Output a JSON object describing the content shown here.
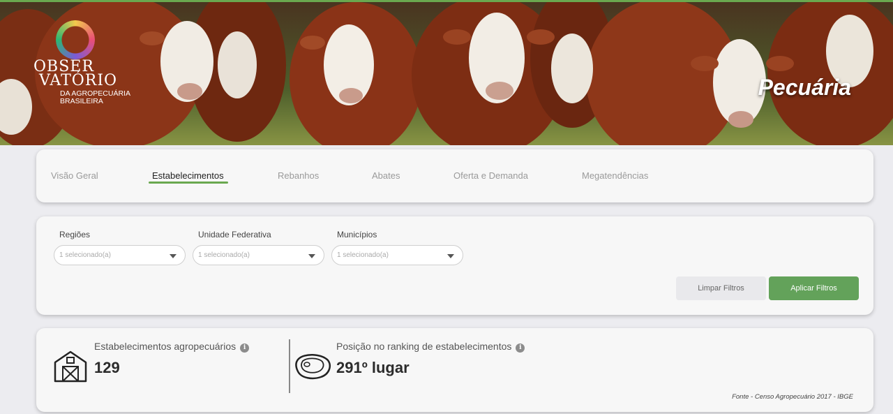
{
  "header": {
    "logo": {
      "line1": "OBSER",
      "line2": "VATÓRIO",
      "line3": "DA AGROPECUÁRIA",
      "line4": "BRASILEIRA"
    },
    "title": "Pecuária"
  },
  "tabs": [
    {
      "label": "Visão Geral",
      "active": false
    },
    {
      "label": "Estabelecimentos",
      "active": true
    },
    {
      "label": "Rebanhos",
      "active": false
    },
    {
      "label": "Abates",
      "active": false
    },
    {
      "label": "Oferta e Demanda",
      "active": false
    },
    {
      "label": "Megatendências",
      "active": false
    }
  ],
  "filters": {
    "regioes": {
      "label": "Regiões",
      "value": "1 selecionado(a)"
    },
    "uf": {
      "label": "Unidade Federativa",
      "value": "1 selecionado(a)"
    },
    "municipios": {
      "label": "Municípios",
      "value": "1 selecionado(a)"
    },
    "clear_label": "Limpar Filtros",
    "apply_label": "Aplicar Filtros"
  },
  "stats": {
    "establishments": {
      "label": "Estabelecimentos agropecuários",
      "value": "129",
      "icon": "barn-icon"
    },
    "ranking": {
      "label": "Posição no ranking de estabelecimentos",
      "value": "291º lugar",
      "icon": "steak-icon"
    },
    "info_glyph": "i",
    "source": "Fonte - Censo Agropecuário 2017 - IBGE"
  },
  "colors": {
    "accent": "#63a25a",
    "underline": "#6aa84f"
  }
}
